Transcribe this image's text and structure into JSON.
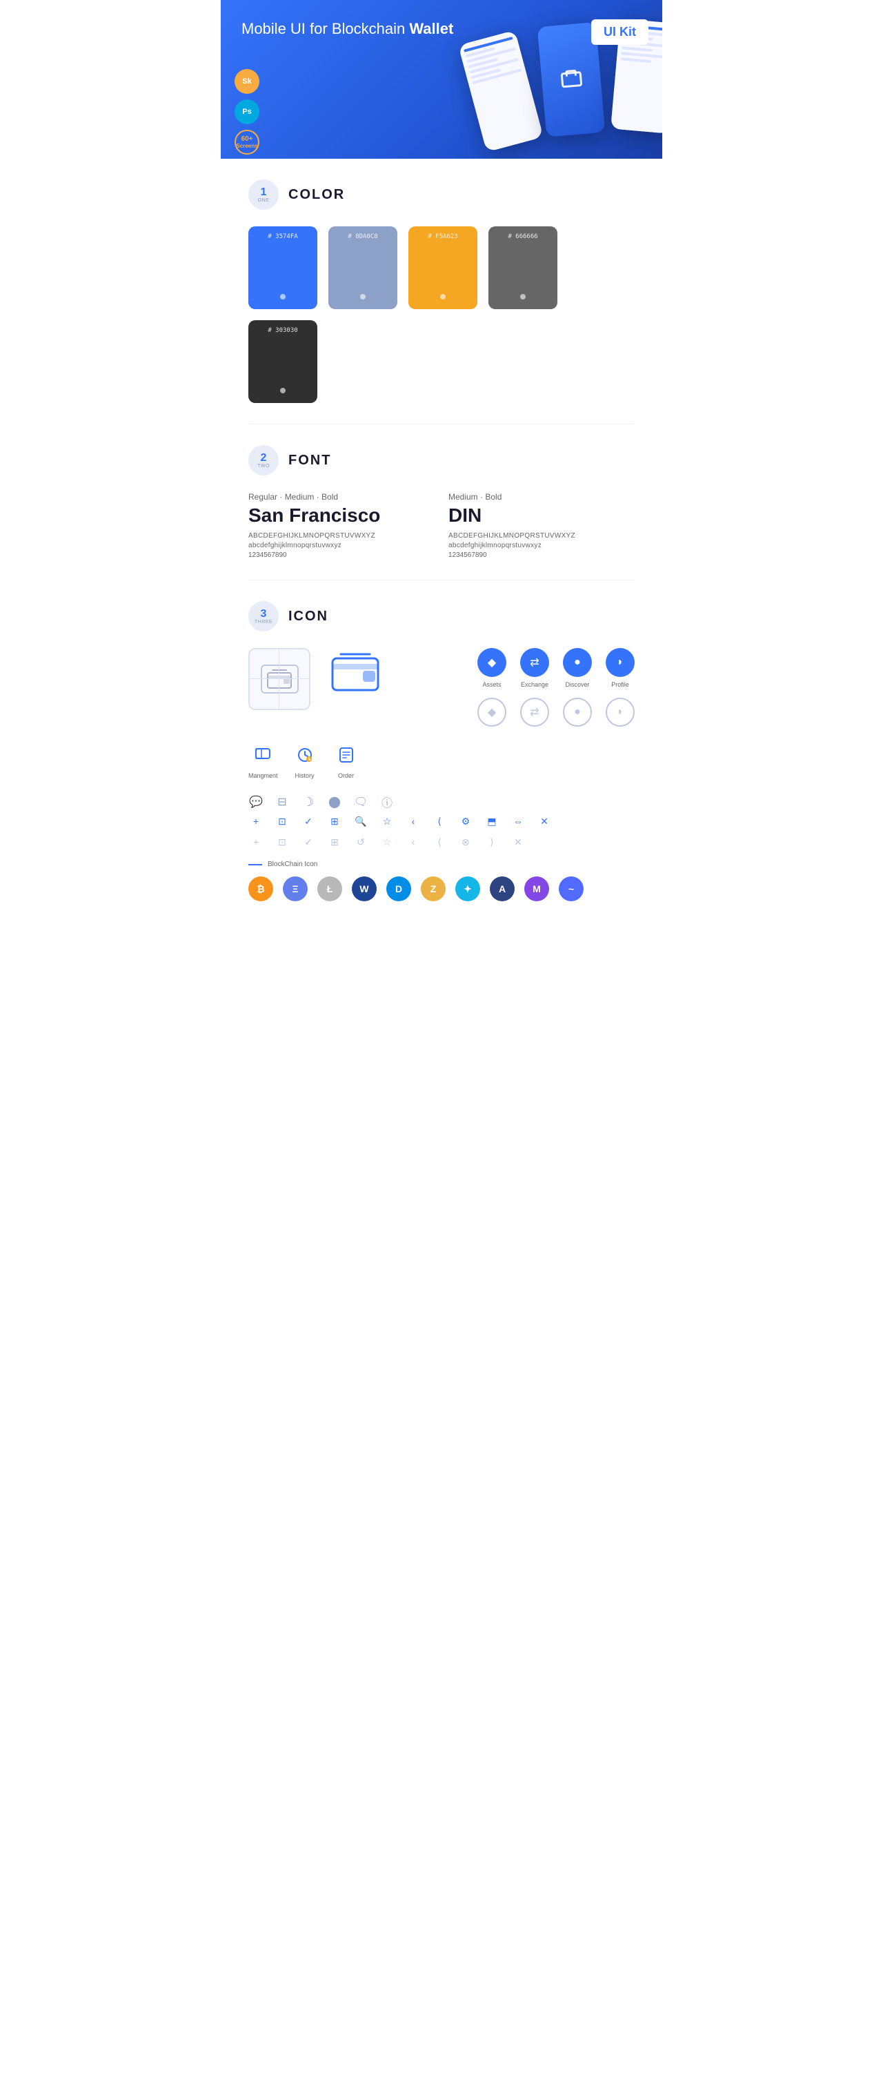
{
  "hero": {
    "title_start": "Mobile UI for Blockchain ",
    "title_bold": "Wallet",
    "badge": "UI Kit",
    "sketch_label": "Sk",
    "ps_label": "Ps",
    "screens_count": "60+",
    "screens_label": "Screens"
  },
  "sections": {
    "color": {
      "number": "1",
      "number_text": "ONE",
      "title": "COLOR",
      "swatches": [
        {
          "hex": "#3574FA",
          "label": "#\n3574FA"
        },
        {
          "hex": "#8DA0C8",
          "label": "#\n8DA0C8"
        },
        {
          "hex": "#F5A623",
          "label": "#\nF5A623"
        },
        {
          "hex": "#666666",
          "label": "#\n666666"
        },
        {
          "hex": "#303030",
          "label": "#\n303030"
        }
      ]
    },
    "font": {
      "number": "2",
      "number_text": "TWO",
      "title": "FONT",
      "fonts": [
        {
          "style": "Regular · Medium · Bold",
          "name": "San Francisco",
          "upper": "ABCDEFGHIJKLMNOPQRSTUVWXYZ",
          "lower": "abcdefghijklmnopqrstuvwxyz",
          "numbers": "1234567890"
        },
        {
          "style": "Medium · Bold",
          "name": "DIN",
          "upper": "ABCDEFGHIJKLMNOPQRSTUVWXYZ",
          "lower": "abcdefghijklmnopqrstuvwxyz",
          "numbers": "1234567890"
        }
      ]
    },
    "icon": {
      "number": "3",
      "number_text": "THREE",
      "title": "ICON",
      "nav_icons": [
        {
          "label": "Assets",
          "glyph": "◆"
        },
        {
          "label": "Exchange",
          "glyph": "⇄"
        },
        {
          "label": "Discover",
          "glyph": "●"
        },
        {
          "label": "Profile",
          "glyph": "◗"
        }
      ],
      "bottom_icons": [
        {
          "label": "Mangment",
          "glyph": "▣"
        },
        {
          "label": "History",
          "glyph": "◷"
        },
        {
          "label": "Order",
          "glyph": "≡"
        }
      ],
      "misc_icons": [
        "▣",
        "≡",
        "◐",
        "●",
        "▩",
        "ℹ"
      ],
      "tool_icons_active": [
        "+",
        "▣",
        "✓",
        "⊞",
        "🔍",
        "☆",
        "‹",
        "⟨",
        "⚙",
        "⬒",
        "⇔",
        "✕"
      ],
      "tool_icons_ghost": [
        "+",
        "▣",
        "✓",
        "⊞",
        "⤿",
        "☆",
        "‹",
        "⟨",
        "⊗",
        "⟩",
        "✕"
      ],
      "blockchain_label": "BlockChain Icon",
      "crypto_icons": [
        {
          "label": "BTC",
          "color": "#F7931A",
          "char": "₿"
        },
        {
          "label": "ETH",
          "color": "#627EEA",
          "char": "Ξ"
        },
        {
          "label": "LTC",
          "color": "#B8B8B8",
          "char": "Ł"
        },
        {
          "label": "WAVES",
          "color": "#1E4596",
          "char": "W"
        },
        {
          "label": "DASH",
          "color": "#008CE7",
          "char": "D"
        },
        {
          "label": "ZEC",
          "color": "#ECB244",
          "char": "Z"
        },
        {
          "label": "XLM",
          "color": "#14B6E7",
          "char": "✦"
        },
        {
          "label": "ARDR",
          "color": "#2E4482",
          "char": "A"
        },
        {
          "label": "MATIC",
          "color": "#8247E5",
          "char": "M"
        },
        {
          "label": "BAND",
          "color": "#516AFF",
          "char": "~"
        }
      ]
    }
  }
}
